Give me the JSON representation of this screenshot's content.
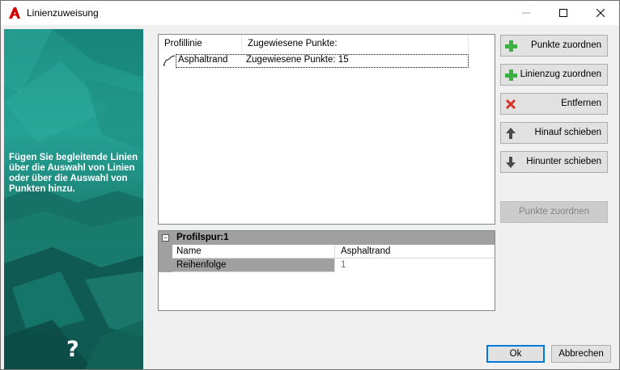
{
  "window": {
    "title": "Linienzuweisung",
    "controls": {
      "minimize": "—",
      "maximize": "☐",
      "close": "✕"
    },
    "icon": "autocad-a-icon"
  },
  "banner": {
    "text": "Fügen Sie begleitende Linien über die Auswahl von Linien oder über die Auswahl von Punkten hinzu.",
    "help": "?"
  },
  "list": {
    "columns": [
      "Profillinie",
      "Zugewiesene Punkte:"
    ],
    "rows": [
      {
        "name": "Asphaltrand",
        "points": "Zugewiesene Punkte: 15",
        "icon": "polyline-icon"
      }
    ]
  },
  "properties": {
    "category": "Profilspur:1",
    "toggle": "−",
    "rows": [
      {
        "name": "Name",
        "value": "Asphaltrand"
      },
      {
        "name": "Reihenfolge",
        "value": "1"
      }
    ]
  },
  "buttons": {
    "assign_points": "Punkte zuordnen",
    "assign_polyline": "Linienzug zuordnen",
    "remove": "Entfernen",
    "move_up": "Hinauf schieben",
    "move_down": "Hinunter schieben",
    "assign_points_disabled": "Punkte zuordnen",
    "ok": "Ok",
    "cancel": "Abbrechen"
  },
  "colors": {
    "add": "#3cb043",
    "remove": "#d9342b",
    "arrow": "#4a4a4a",
    "banner_teal": "#1d8e83",
    "title_icon_red": "#d40000"
  }
}
